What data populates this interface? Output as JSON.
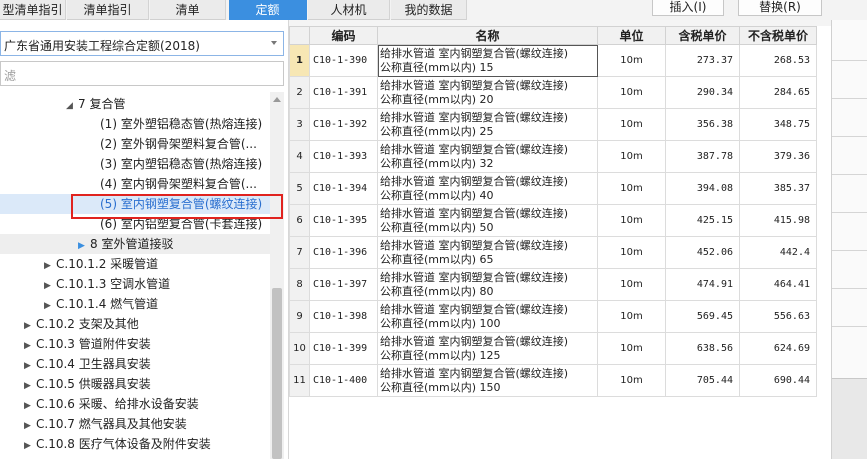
{
  "tabs": [
    {
      "label": "型清单指引"
    },
    {
      "label": "清单指引"
    },
    {
      "label": "清单"
    },
    {
      "label": "定额"
    },
    {
      "label": "人材机"
    },
    {
      "label": "我的数据"
    }
  ],
  "actions": {
    "insert_label": "插入(I)",
    "replace_label": "替换(R)"
  },
  "library": {
    "selected": "广东省通用安装工程综合定额(2018)"
  },
  "filter": {
    "placeholder": "滤"
  },
  "tree": [
    {
      "label": "7 复合管",
      "toggle": "◢"
    },
    {
      "label": "(1) 室外塑铝稳态管(热熔连接)"
    },
    {
      "label": "(2) 室外钢骨架塑料复合管(..."
    },
    {
      "label": "(3) 室内塑铝稳态管(热熔连接)"
    },
    {
      "label": "(4) 室内钢骨架塑料复合管(..."
    },
    {
      "label": "(5) 室内钢塑复合管(螺纹连接)"
    },
    {
      "label": "(6) 室内铝塑复合管(卡套连接)"
    },
    {
      "label": "8 室外管道接驳",
      "toggle": "▶"
    },
    {
      "label": "C.10.1.2 采暖管道",
      "toggle": "▶"
    },
    {
      "label": "C.10.1.3 空调水管道",
      "toggle": "▶"
    },
    {
      "label": "C.10.1.4 燃气管道",
      "toggle": "▶"
    },
    {
      "label": "C.10.2 支架及其他",
      "toggle": "▶"
    },
    {
      "label": "C.10.3 管道附件安装",
      "toggle": "▶"
    },
    {
      "label": "C.10.4 卫生器具安装",
      "toggle": "▶"
    },
    {
      "label": "C.10.5 供暖器具安装",
      "toggle": "▶"
    },
    {
      "label": "C.10.6 采暖、给排水设备安装",
      "toggle": "▶"
    },
    {
      "label": "C.10.7 燃气器具及其他安装",
      "toggle": "▶"
    },
    {
      "label": "C.10.8 医疗气体设备及附件安装",
      "toggle": "▶"
    }
  ],
  "grid": {
    "headers": {
      "code": "编码",
      "name": "名称",
      "unit": "单位",
      "price_tax": "含税单价",
      "price_notax": "不含税单价"
    },
    "rows": [
      {
        "idx": "1",
        "code": "C10-1-390",
        "name1": "给排水管道 室内钢塑复合管(螺纹连接)",
        "name2": "公称直径(mm以内) 15",
        "unit": "10m",
        "price_tax": "273.37",
        "price_notax": "268.53"
      },
      {
        "idx": "2",
        "code": "C10-1-391",
        "name1": "给排水管道 室内钢塑复合管(螺纹连接)",
        "name2": "公称直径(mm以内) 20",
        "unit": "10m",
        "price_tax": "290.34",
        "price_notax": "284.65"
      },
      {
        "idx": "3",
        "code": "C10-1-392",
        "name1": "给排水管道 室内钢塑复合管(螺纹连接)",
        "name2": "公称直径(mm以内) 25",
        "unit": "10m",
        "price_tax": "356.38",
        "price_notax": "348.75"
      },
      {
        "idx": "4",
        "code": "C10-1-393",
        "name1": "给排水管道 室内钢塑复合管(螺纹连接)",
        "name2": "公称直径(mm以内) 32",
        "unit": "10m",
        "price_tax": "387.78",
        "price_notax": "379.36"
      },
      {
        "idx": "5",
        "code": "C10-1-394",
        "name1": "给排水管道 室内钢塑复合管(螺纹连接)",
        "name2": "公称直径(mm以内) 40",
        "unit": "10m",
        "price_tax": "394.08",
        "price_notax": "385.37"
      },
      {
        "idx": "6",
        "code": "C10-1-395",
        "name1": "给排水管道 室内钢塑复合管(螺纹连接)",
        "name2": "公称直径(mm以内) 50",
        "unit": "10m",
        "price_tax": "425.15",
        "price_notax": "415.98"
      },
      {
        "idx": "7",
        "code": "C10-1-396",
        "name1": "给排水管道 室内钢塑复合管(螺纹连接)",
        "name2": "公称直径(mm以内) 65",
        "unit": "10m",
        "price_tax": "452.06",
        "price_notax": "442.4"
      },
      {
        "idx": "8",
        "code": "C10-1-397",
        "name1": "给排水管道 室内钢塑复合管(螺纹连接)",
        "name2": "公称直径(mm以内) 80",
        "unit": "10m",
        "price_tax": "474.91",
        "price_notax": "464.41"
      },
      {
        "idx": "9",
        "code": "C10-1-398",
        "name1": "给排水管道 室内钢塑复合管(螺纹连接)",
        "name2": "公称直径(mm以内) 100",
        "unit": "10m",
        "price_tax": "569.45",
        "price_notax": "556.63"
      },
      {
        "idx": "10",
        "code": "C10-1-399",
        "name1": "给排水管道 室内钢塑复合管(螺纹连接)",
        "name2": "公称直径(mm以内) 125",
        "unit": "10m",
        "price_tax": "638.56",
        "price_notax": "624.69"
      },
      {
        "idx": "11",
        "code": "C10-1-400",
        "name1": "给排水管道 室内钢塑复合管(螺纹连接)",
        "name2": "公称直径(mm以内) 150",
        "unit": "10m",
        "price_tax": "705.44",
        "price_notax": "690.44"
      }
    ]
  },
  "colors": {
    "active_tab": "#3b8fe0",
    "highlight_box": "#e0231f",
    "selected_row": "#dbe9f9",
    "current_row_index": "#f7e7b4"
  }
}
